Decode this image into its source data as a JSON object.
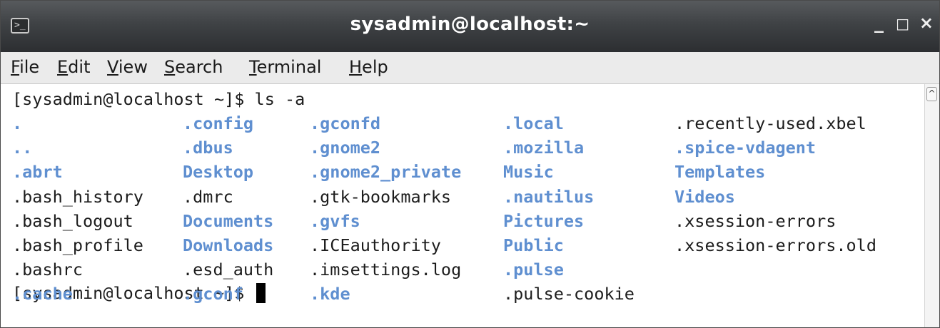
{
  "window": {
    "title": "sysadmin@localhost:~",
    "terminal_icon": "terminal-icon",
    "controls": {
      "minimize": "_",
      "maximize": "□",
      "close": "×"
    }
  },
  "menu": {
    "items": [
      {
        "mnemonic": "F",
        "rest": "ile"
      },
      {
        "mnemonic": "E",
        "rest": "dit"
      },
      {
        "mnemonic": "V",
        "rest": "iew"
      },
      {
        "mnemonic": "S",
        "rest": "earch"
      },
      {
        "mnemonic": "T",
        "rest": "erminal"
      },
      {
        "mnemonic": "H",
        "rest": "elp"
      }
    ]
  },
  "terminal": {
    "command_line": "[sysadmin@localhost ~]$ ls -a",
    "prompt_line": "[sysadmin@localhost ~]$ ",
    "colors": {
      "directory": "#5f8fd0",
      "file": "#1c1c1c"
    },
    "listing": [
      [
        {
          "text": ".",
          "type": "dir"
        },
        {
          "text": ".config",
          "type": "dir"
        },
        {
          "text": ".gconfd",
          "type": "dir"
        },
        {
          "text": ".local",
          "type": "dir"
        },
        {
          "text": ".recently-used.xbel",
          "type": "file"
        }
      ],
      [
        {
          "text": "..",
          "type": "dir"
        },
        {
          "text": ".dbus",
          "type": "dir"
        },
        {
          "text": ".gnome2",
          "type": "dir"
        },
        {
          "text": ".mozilla",
          "type": "dir"
        },
        {
          "text": ".spice-vdagent",
          "type": "dir"
        }
      ],
      [
        {
          "text": ".abrt",
          "type": "dir"
        },
        {
          "text": "Desktop",
          "type": "dir"
        },
        {
          "text": ".gnome2_private",
          "type": "dir"
        },
        {
          "text": "Music",
          "type": "dir"
        },
        {
          "text": "Templates",
          "type": "dir"
        }
      ],
      [
        {
          "text": ".bash_history",
          "type": "file"
        },
        {
          "text": ".dmrc",
          "type": "file"
        },
        {
          "text": ".gtk-bookmarks",
          "type": "file"
        },
        {
          "text": ".nautilus",
          "type": "dir"
        },
        {
          "text": "Videos",
          "type": "dir"
        }
      ],
      [
        {
          "text": ".bash_logout",
          "type": "file"
        },
        {
          "text": "Documents",
          "type": "dir"
        },
        {
          "text": ".gvfs",
          "type": "dir"
        },
        {
          "text": "Pictures",
          "type": "dir"
        },
        {
          "text": ".xsession-errors",
          "type": "file"
        }
      ],
      [
        {
          "text": ".bash_profile",
          "type": "file"
        },
        {
          "text": "Downloads",
          "type": "dir"
        },
        {
          "text": ".ICEauthority",
          "type": "file"
        },
        {
          "text": "Public",
          "type": "dir"
        },
        {
          "text": ".xsession-errors.old",
          "type": "file"
        }
      ],
      [
        {
          "text": ".bashrc",
          "type": "file"
        },
        {
          "text": ".esd_auth",
          "type": "file"
        },
        {
          "text": ".imsettings.log",
          "type": "file"
        },
        {
          "text": ".pulse",
          "type": "dir"
        },
        null
      ],
      [
        {
          "text": ".cache",
          "type": "dir"
        },
        {
          "text": ".gconf",
          "type": "dir"
        },
        {
          "text": ".kde",
          "type": "dir"
        },
        {
          "text": ".pulse-cookie",
          "type": "file"
        },
        null
      ]
    ]
  },
  "scrollbar": {
    "up_arrow": "^"
  }
}
